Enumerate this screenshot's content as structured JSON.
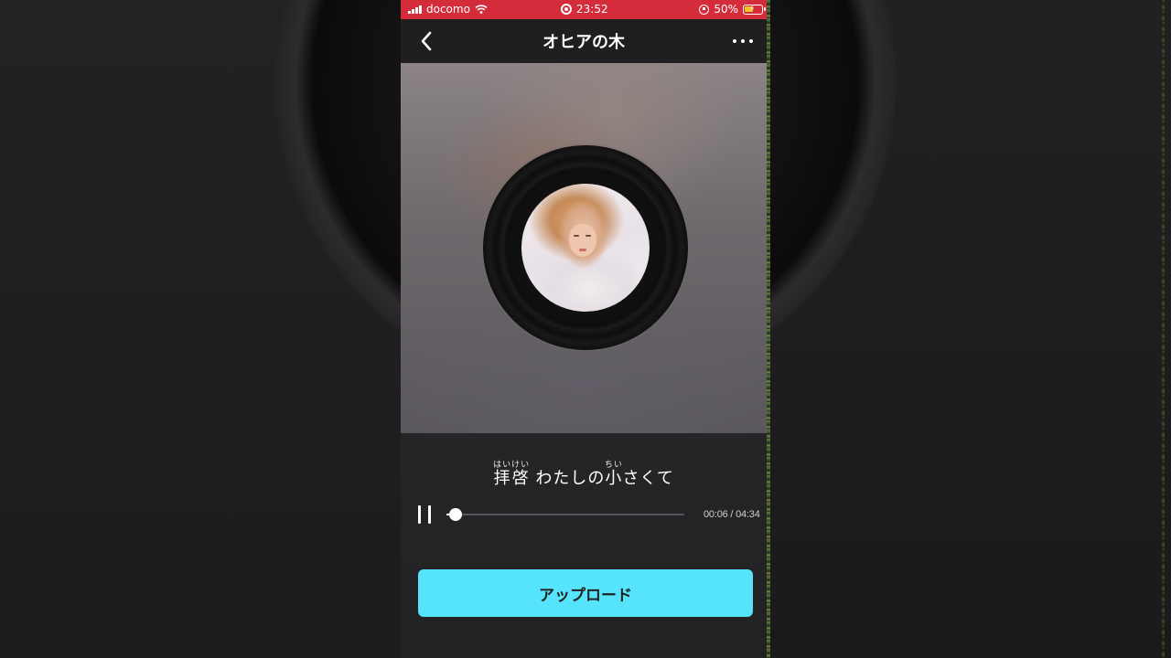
{
  "status_bar": {
    "carrier": "docomo",
    "time": "23:52",
    "battery_percent": "50%",
    "battery_level": 0.5
  },
  "nav": {
    "title": "オヒアの木",
    "back_icon": "chevron-left-icon",
    "more_icon": "ellipsis-icon"
  },
  "lyrics": {
    "segments": [
      {
        "text": "拝啓",
        "ruby": "はいけい"
      },
      {
        "text": " わたしの",
        "ruby": ""
      },
      {
        "text": "小",
        "ruby": "ちい"
      },
      {
        "text": "さくて",
        "ruby": ""
      }
    ]
  },
  "player": {
    "state_icon": "pause-icon",
    "elapsed": "00:06",
    "duration": "04:34",
    "time_display": "00:06 / 04:34",
    "progress_fraction": 0.022
  },
  "actions": {
    "upload_label": "アップロード"
  },
  "colors": {
    "status_bar": "#d42c3a",
    "accent_button": "#55e4fb",
    "nav_bar": "#1f1f22"
  }
}
